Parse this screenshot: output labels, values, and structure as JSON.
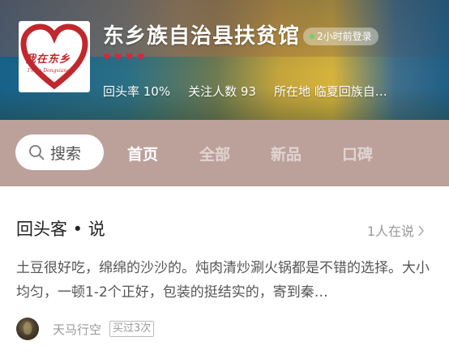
{
  "shop": {
    "name": "东乡族自治县扶贫馆",
    "last_login": "2小时前登录",
    "logo_text": "我在东乡",
    "logo_subtext": "I'm in Dongxiang",
    "hearts": 4,
    "return_rate": "回头率 10%",
    "followers": "关注人数 93",
    "location": "所在地 临夏回族自…"
  },
  "nav": {
    "search_label": "搜索",
    "tabs": [
      "首页",
      "全部",
      "新品",
      "口碑"
    ],
    "active_tab": "首页"
  },
  "reviews": {
    "title": "回头客 • 说",
    "online_count": "1人在说",
    "content": "土豆很好吃，绵绵的沙沙的。炖肉清炒涮火锅都是不错的选择。大小均匀，一顿1-2个正好，包装的挺结实的，寄到秦…",
    "reviewer_name": "天马行空",
    "purchase_count": "买过3次"
  },
  "colors": {
    "nav_bg": "#bca19b",
    "heart": "#e0233b",
    "logo_red": "#c0282d",
    "online_dot": "#63d66b"
  },
  "icons": [
    "search-icon",
    "heart-icon",
    "chevron-right-icon",
    "online-dot-icon"
  ]
}
